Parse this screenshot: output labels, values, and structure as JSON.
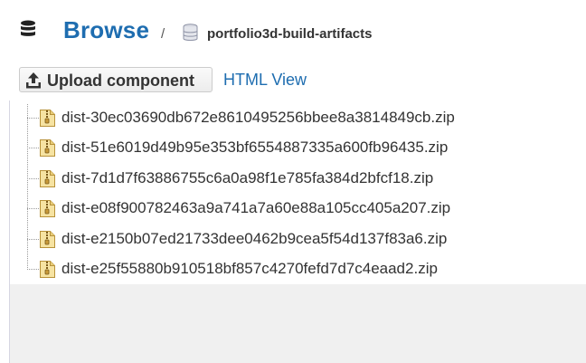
{
  "header": {
    "title": "Browse",
    "separator": "/",
    "bucket_name": "portfolio3d-build-artifacts",
    "title_color": "#1e6db0"
  },
  "toolbar": {
    "upload_label": "Upload component",
    "html_view_label": "HTML View",
    "upload_icon": "upload-icon"
  },
  "files": {
    "icon": "zip-file-icon",
    "items": [
      "dist-30ec03690db672e8610495256bbee8a3814849cb.zip",
      "dist-51e6019d49b95e353bf6554887335a600fb96435.zip",
      "dist-7d1d7f63886755c6a0a98f1e785fa384d2bfcf18.zip",
      "dist-e08f900782463a9a741a7a60e88a105cc405a207.zip",
      "dist-e2150b07ed21733dee0462b9cea5f54d137f83a6.zip",
      "dist-e25f55880b910518bf857c4270fefd7d7c4eaad2.zip"
    ]
  }
}
